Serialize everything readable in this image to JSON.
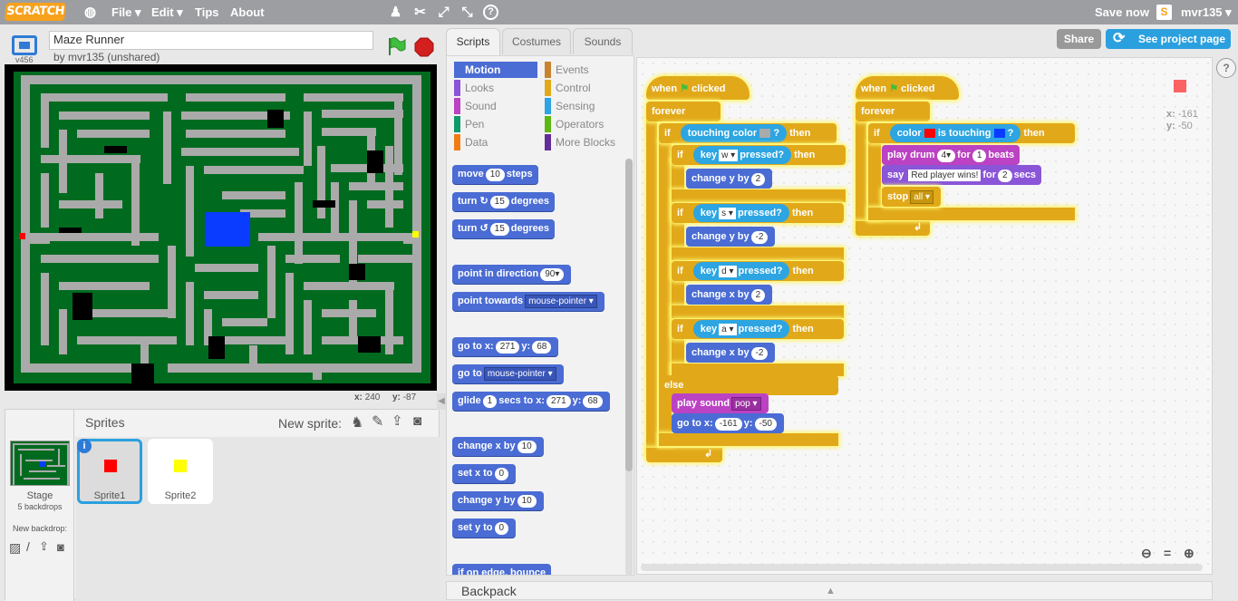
{
  "topbar": {
    "logo": "SCRATCH",
    "menu": [
      "File ▾",
      "Edit ▾",
      "Tips",
      "About"
    ],
    "save_now": "Save now",
    "username": "mvr135 ▾"
  },
  "stage_header": {
    "version": "v456",
    "project_title": "Maze Runner",
    "byline": "by mvr135 (unshared)"
  },
  "coords": {
    "x_label": "x:",
    "x": "240",
    "y_label": "y:",
    "y": "-87"
  },
  "sprites_panel": {
    "title": "Sprites",
    "new_sprite": "New sprite:",
    "stage_label": "Stage",
    "backdrops": "5 backdrops",
    "new_backdrop": "New backdrop:",
    "sprites": [
      {
        "name": "Sprite1",
        "color": "#ff0000"
      },
      {
        "name": "Sprite2",
        "color": "#ffff00"
      }
    ]
  },
  "tabs": [
    "Scripts",
    "Costumes",
    "Sounds"
  ],
  "categories": [
    {
      "label": "Motion",
      "color": "#4a6cd4"
    },
    {
      "label": "Events",
      "color": "#c88330"
    },
    {
      "label": "Looks",
      "color": "#8a55d7"
    },
    {
      "label": "Control",
      "color": "#e1a91a"
    },
    {
      "label": "Sound",
      "color": "#bb42c3"
    },
    {
      "label": "Sensing",
      "color": "#2ca5e2"
    },
    {
      "label": "Pen",
      "color": "#0e9a6c"
    },
    {
      "label": "Operators",
      "color": "#5cb712"
    },
    {
      "label": "Data",
      "color": "#ee7d16"
    },
    {
      "label": "More Blocks",
      "color": "#632d99"
    }
  ],
  "palette": {
    "move": "move",
    "move_n": "10",
    "steps": "steps",
    "turn": "turn",
    "turn_r": "15",
    "turn_l": "15",
    "degrees": "degrees",
    "point_dir": "point in direction",
    "point_dir_v": "90▾",
    "point_towards": "point towards",
    "point_towards_v": "mouse-pointer ▾",
    "goto": "go to x:",
    "goto_x": "271",
    "goto_y_l": "y:",
    "goto_y": "68",
    "goto2": "go to",
    "goto2_v": "mouse-pointer ▾",
    "glide": "glide",
    "glide_n": "1",
    "glide_t": "secs to x:",
    "glide_x": "271",
    "glide_y_l": "y:",
    "glide_y": "68",
    "change_x": "change x by",
    "change_x_v": "10",
    "set_x": "set x to",
    "set_x_v": "0",
    "change_y": "change y by",
    "change_y_v": "10",
    "set_y": "set y to",
    "set_y_v": "0",
    "bounce": "if on edge, bounce"
  },
  "script1": {
    "when": "when",
    "clicked": "clicked",
    "forever": "forever",
    "if": "if",
    "touching_color": "touching color",
    "q": "?",
    "then": "then",
    "key": "key",
    "pressed": "pressed?",
    "k_w": "w ▾",
    "k_s": "s ▾",
    "k_d": "d ▾",
    "k_a": "a ▾",
    "change_y": "change y by",
    "change_x": "change x by",
    "v_2": "2",
    "v_m2": "-2",
    "else": "else",
    "play_sound": "play sound",
    "pop": "pop ▾",
    "goto": "go to x:",
    "gx": "-161",
    "gy_l": "y:",
    "gy": "-50"
  },
  "script2": {
    "when": "when",
    "clicked": "clicked",
    "forever": "forever",
    "if": "if",
    "color": "color",
    "is_touching": "is touching",
    "q": "?",
    "then": "then",
    "play_drum": "play drum",
    "drum": "4▾",
    "for": "for",
    "beats_n": "1",
    "beats": "beats",
    "say": "say",
    "say_text": "Red player wins!",
    "for2": "for",
    "secs_n": "2",
    "secs": "secs",
    "stop": "stop",
    "stop_v": "all ▾"
  },
  "sprite_info": {
    "x_label": "x:",
    "x": "-161",
    "y_label": "y:",
    "y": "-50"
  },
  "buttons": {
    "share": "Share",
    "see_project": "See project page"
  },
  "backpack": "Backpack"
}
